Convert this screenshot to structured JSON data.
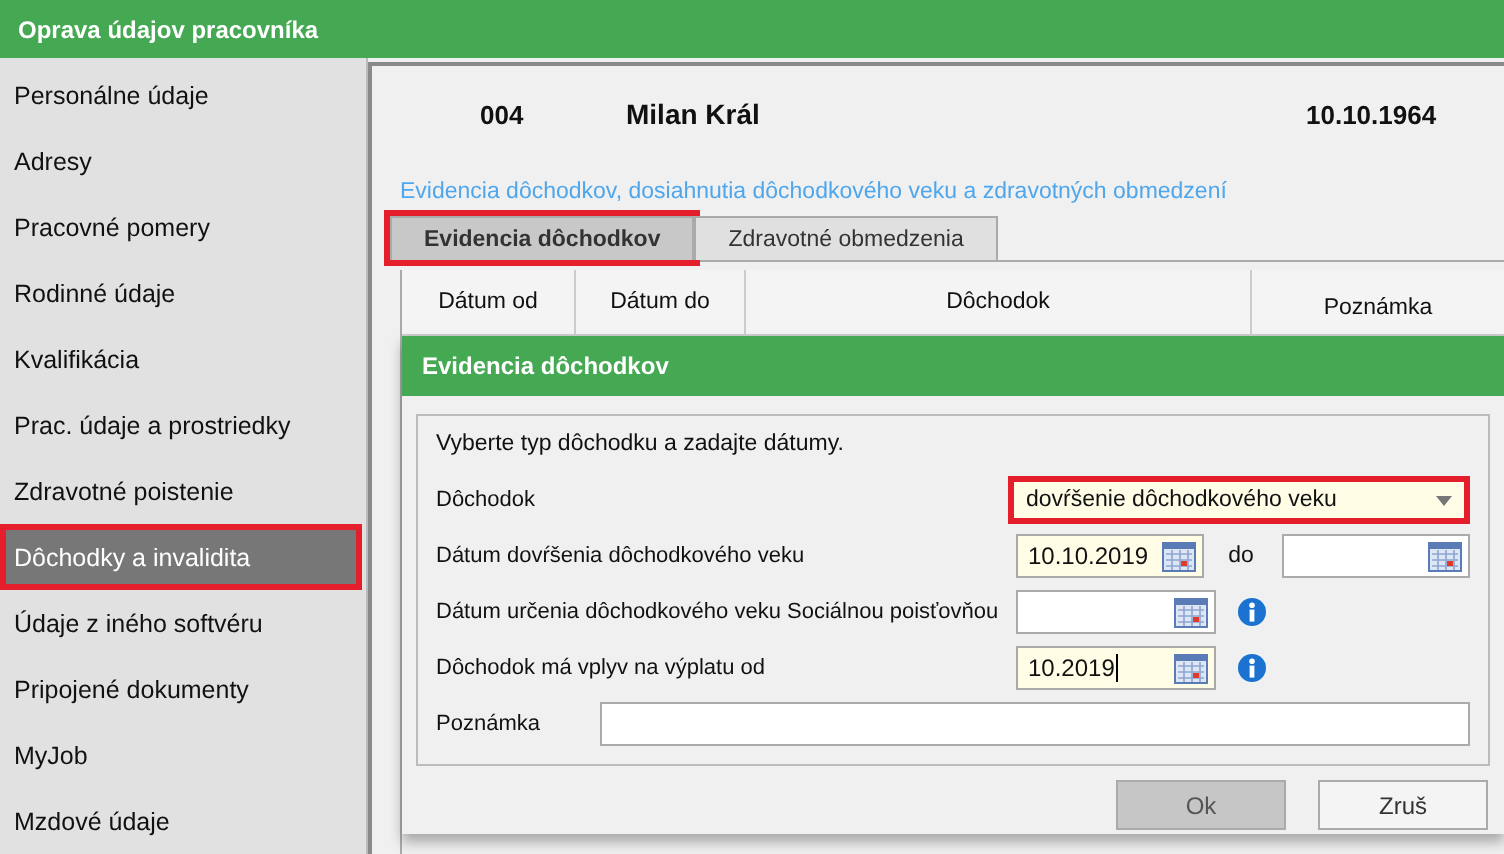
{
  "window": {
    "title": "Oprava údajov pracovníka"
  },
  "sidebar": {
    "items": [
      {
        "label": "Personálne údaje",
        "selected": false,
        "highlighted": false
      },
      {
        "label": "Adresy",
        "selected": false,
        "highlighted": false
      },
      {
        "label": "Pracovné pomery",
        "selected": false,
        "highlighted": false
      },
      {
        "label": "Rodinné údaje",
        "selected": false,
        "highlighted": false
      },
      {
        "label": "Kvalifikácia",
        "selected": false,
        "highlighted": false
      },
      {
        "label": "Prac. údaje a prostriedky",
        "selected": false,
        "highlighted": false
      },
      {
        "label": "Zdravotné poistenie",
        "selected": false,
        "highlighted": false
      },
      {
        "label": "Dôchodky a invalidita",
        "selected": true,
        "highlighted": true
      },
      {
        "label": "Údaje z iného softvéru",
        "selected": false,
        "highlighted": false
      },
      {
        "label": "Pripojené dokumenty",
        "selected": false,
        "highlighted": false
      },
      {
        "label": "MyJob",
        "selected": false,
        "highlighted": false
      },
      {
        "label": "Mzdové údaje",
        "selected": false,
        "highlighted": false
      }
    ]
  },
  "employee": {
    "number": "004",
    "name": "Milan Král",
    "birth_date": "10.10.1964"
  },
  "section_caption": "Evidencia dôchodkov, dosiahnutia dôchodkového veku a zdravotných obmedzení",
  "tabs": [
    {
      "label": "Evidencia dôchodkov",
      "selected": true,
      "highlighted": true
    },
    {
      "label": "Zdravotné obmedzenia",
      "selected": false,
      "highlighted": false
    }
  ],
  "table": {
    "columns": [
      "Dátum od",
      "Dátum do",
      "Dôchodok",
      "Poznámka"
    ]
  },
  "dialog": {
    "title": "Evidencia dôchodkov",
    "intro": "Vyberte typ dôchodku a zadajte dátumy.",
    "rows": [
      {
        "kind": "select",
        "label": "Dôchodok",
        "value": "dovŕšenie dôchodkového veku",
        "highlighted": true
      },
      {
        "kind": "date",
        "label": "Dátum dovŕšenia dôchodkového veku",
        "value": "10.10.2019",
        "to_label": "do",
        "info": false,
        "focused": false
      },
      {
        "kind": "date",
        "label": "Dátum určenia dôchodkového veku Sociálnou poisťovňou",
        "info": true,
        "focused": false
      },
      {
        "kind": "date",
        "label": "Dôchodok má vplyv na výplatu od",
        "value": "10.2019",
        "info": true,
        "focused": true
      },
      {
        "kind": "text",
        "label": "Poznámka"
      }
    ],
    "buttons": [
      {
        "label": "Ok",
        "kind": "primary"
      },
      {
        "label": "Zruš",
        "kind": "secondary"
      }
    ]
  }
}
